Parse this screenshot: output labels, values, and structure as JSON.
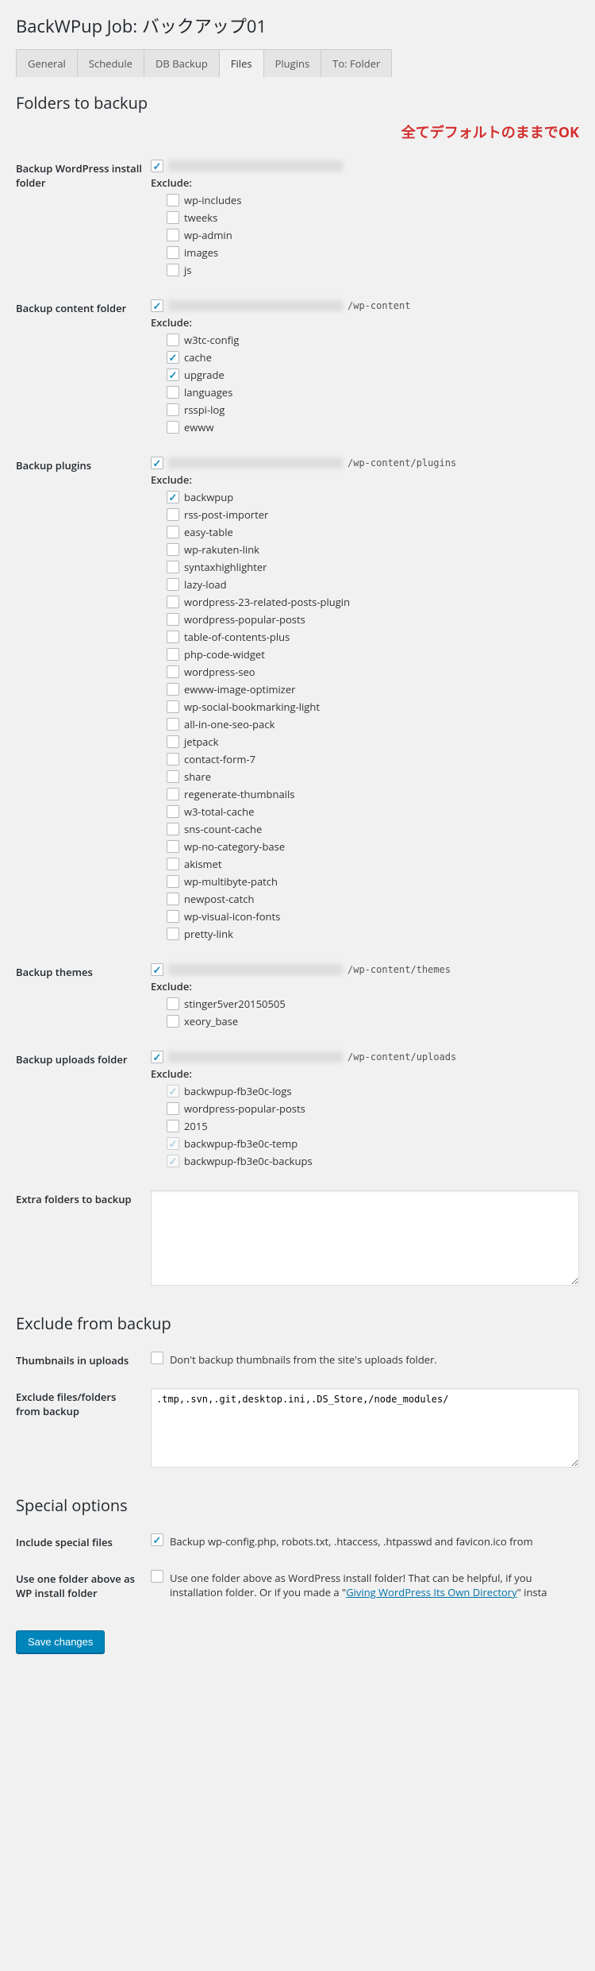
{
  "page_title": "BackWPup Job: バックアップ01",
  "tabs": [
    {
      "label": "General",
      "active": false
    },
    {
      "label": "Schedule",
      "active": false
    },
    {
      "label": "DB Backup",
      "active": false
    },
    {
      "label": "Files",
      "active": true
    },
    {
      "label": "Plugins",
      "active": false
    },
    {
      "label": "To: Folder",
      "active": false
    }
  ],
  "annotation": "全てデフォルトのままでOK",
  "sections": {
    "folders_heading": "Folders to backup",
    "exclude_heading": "Exclude from backup",
    "special_heading": "Special options"
  },
  "labels": {
    "exclude": "Exclude:",
    "save_changes": "Save changes"
  },
  "folders": {
    "install": {
      "title": "Backup WordPress install folder",
      "checked": true,
      "path_suffix": "",
      "excludes": [
        {
          "name": "wp-includes",
          "checked": false
        },
        {
          "name": "tweeks",
          "checked": false
        },
        {
          "name": "wp-admin",
          "checked": false
        },
        {
          "name": "images",
          "checked": false
        },
        {
          "name": "js",
          "checked": false
        }
      ]
    },
    "content": {
      "title": "Backup content folder",
      "checked": true,
      "path_suffix": "/wp-content",
      "excludes": [
        {
          "name": "w3tc-config",
          "checked": false
        },
        {
          "name": "cache",
          "checked": true
        },
        {
          "name": "upgrade",
          "checked": true
        },
        {
          "name": "languages",
          "checked": false
        },
        {
          "name": "rsspi-log",
          "checked": false
        },
        {
          "name": "ewww",
          "checked": false
        }
      ]
    },
    "plugins": {
      "title": "Backup plugins",
      "checked": true,
      "path_suffix": "/wp-content/plugins",
      "excludes": [
        {
          "name": "backwpup",
          "checked": true
        },
        {
          "name": "rss-post-importer",
          "checked": false
        },
        {
          "name": "easy-table",
          "checked": false
        },
        {
          "name": "wp-rakuten-link",
          "checked": false
        },
        {
          "name": "syntaxhighlighter",
          "checked": false
        },
        {
          "name": "lazy-load",
          "checked": false
        },
        {
          "name": "wordpress-23-related-posts-plugin",
          "checked": false
        },
        {
          "name": "wordpress-popular-posts",
          "checked": false
        },
        {
          "name": "table-of-contents-plus",
          "checked": false
        },
        {
          "name": "php-code-widget",
          "checked": false
        },
        {
          "name": "wordpress-seo",
          "checked": false
        },
        {
          "name": "ewww-image-optimizer",
          "checked": false
        },
        {
          "name": "wp-social-bookmarking-light",
          "checked": false
        },
        {
          "name": "all-in-one-seo-pack",
          "checked": false
        },
        {
          "name": "jetpack",
          "checked": false
        },
        {
          "name": "contact-form-7",
          "checked": false
        },
        {
          "name": "share",
          "checked": false
        },
        {
          "name": "regenerate-thumbnails",
          "checked": false
        },
        {
          "name": "w3-total-cache",
          "checked": false
        },
        {
          "name": "sns-count-cache",
          "checked": false
        },
        {
          "name": "wp-no-category-base",
          "checked": false
        },
        {
          "name": "akismet",
          "checked": false
        },
        {
          "name": "wp-multibyte-patch",
          "checked": false
        },
        {
          "name": "newpost-catch",
          "checked": false
        },
        {
          "name": "wp-visual-icon-fonts",
          "checked": false
        },
        {
          "name": "pretty-link",
          "checked": false
        }
      ]
    },
    "themes": {
      "title": "Backup themes",
      "checked": true,
      "path_suffix": "/wp-content/themes",
      "excludes": [
        {
          "name": "stinger5ver20150505",
          "checked": false
        },
        {
          "name": "xeory_base",
          "checked": false
        }
      ]
    },
    "uploads": {
      "title": "Backup uploads folder",
      "checked": true,
      "path_suffix": "/wp-content/uploads",
      "excludes": [
        {
          "name": "backwpup-fb3e0c-logs",
          "checked": true,
          "locked": true
        },
        {
          "name": "wordpress-popular-posts",
          "checked": false
        },
        {
          "name": "2015",
          "checked": false
        },
        {
          "name": "backwpup-fb3e0c-temp",
          "checked": true,
          "locked": true
        },
        {
          "name": "backwpup-fb3e0c-backups",
          "checked": true,
          "locked": true
        }
      ]
    },
    "extra": {
      "title": "Extra folders to backup",
      "value": ""
    }
  },
  "exclude": {
    "thumbnails": {
      "title": "Thumbnails in uploads",
      "checked": false,
      "label": "Don't backup thumbnails from the site's uploads folder."
    },
    "files": {
      "title": "Exclude files/folders from backup",
      "value": ".tmp,.svn,.git,desktop.ini,.DS_Store,/node_modules/"
    }
  },
  "special": {
    "include_special": {
      "title": "Include special files",
      "checked": true,
      "label": "Backup wp-config.php, robots.txt, .htaccess, .htpasswd and favicon.ico from"
    },
    "one_folder_above": {
      "title": "Use one folder above as WP install folder",
      "checked": false,
      "label_pre": "Use one folder above as WordPress install folder! That can be helpful, if you",
      "label_mid": "installation folder. Or if you made a \"",
      "link_text": "Giving WordPress Its Own Directory",
      "label_post": "\" insta"
    }
  }
}
